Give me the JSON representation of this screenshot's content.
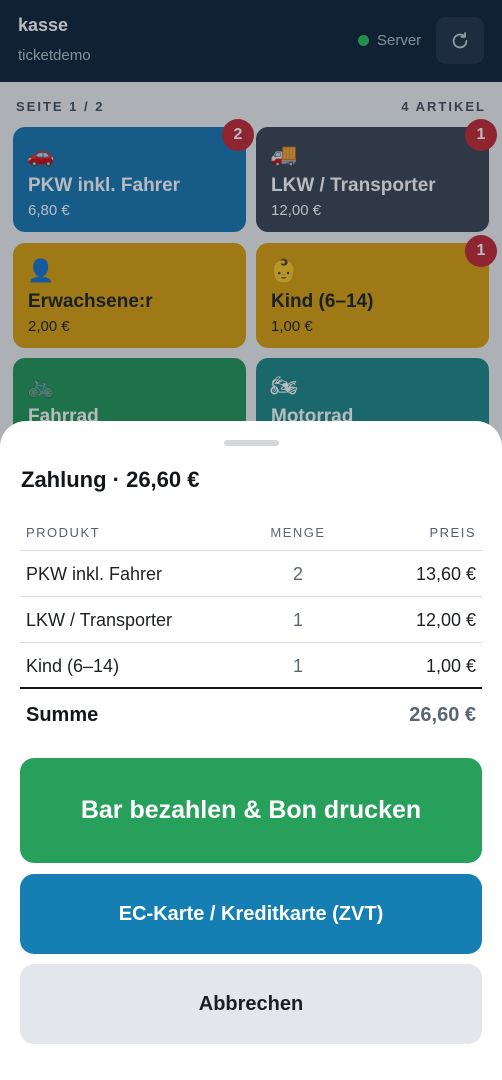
{
  "header": {
    "title": "kasse",
    "subtitle": "ticketdemo",
    "server_label": "Server",
    "server_status_color": "#2bbf5b",
    "refresh_icon": "refresh-icon"
  },
  "grid": {
    "page_label": "SEITE 1 / 2",
    "item_count_label": "4 ARTIKEL",
    "tiles": [
      {
        "emoji": "🚗",
        "name": "PKW inkl. Fahrer",
        "price": "6,80 €",
        "badge": "2",
        "color": "#1a78b4"
      },
      {
        "emoji": "🚚",
        "name": "LKW / Transporter",
        "price": "12,00 €",
        "badge": "1",
        "color": "#3b4654"
      },
      {
        "emoji": "👤",
        "name": "Erwachsene:r",
        "price": "2,00 €",
        "badge": "",
        "color": "#dca20f"
      },
      {
        "emoji": "👶",
        "name": "Kind (6–14)",
        "price": "1,00 €",
        "badge": "1",
        "color": "#dca20f"
      },
      {
        "emoji": "🚲",
        "name": "Fahrrad",
        "price": "",
        "badge": "",
        "color": "#23995a"
      },
      {
        "emoji": "🏍",
        "name": "Motorrad",
        "price": "",
        "badge": "",
        "color": "#1f8a8a"
      }
    ]
  },
  "payment": {
    "title": "Zahlung · 26,60 €",
    "columns": {
      "product": "PRODUKT",
      "qty": "MENGE",
      "price": "PREIS"
    },
    "rows": [
      {
        "product": "PKW inkl. Fahrer",
        "qty": "2",
        "price": "13,60 €"
      },
      {
        "product": "LKW / Transporter",
        "qty": "1",
        "price": "12,00 €"
      },
      {
        "product": "Kind (6–14)",
        "qty": "1",
        "price": "1,00 €"
      }
    ],
    "sum_label": "Summe",
    "sum_value": "26,60 €",
    "btn_cash": "Bar bezahlen & Bon drucken",
    "btn_card": "EC-Karte / Kreditkarte (ZVT)",
    "btn_cancel": "Abbrechen",
    "color_cash": "#26a05a",
    "color_card": "#157fb3"
  }
}
